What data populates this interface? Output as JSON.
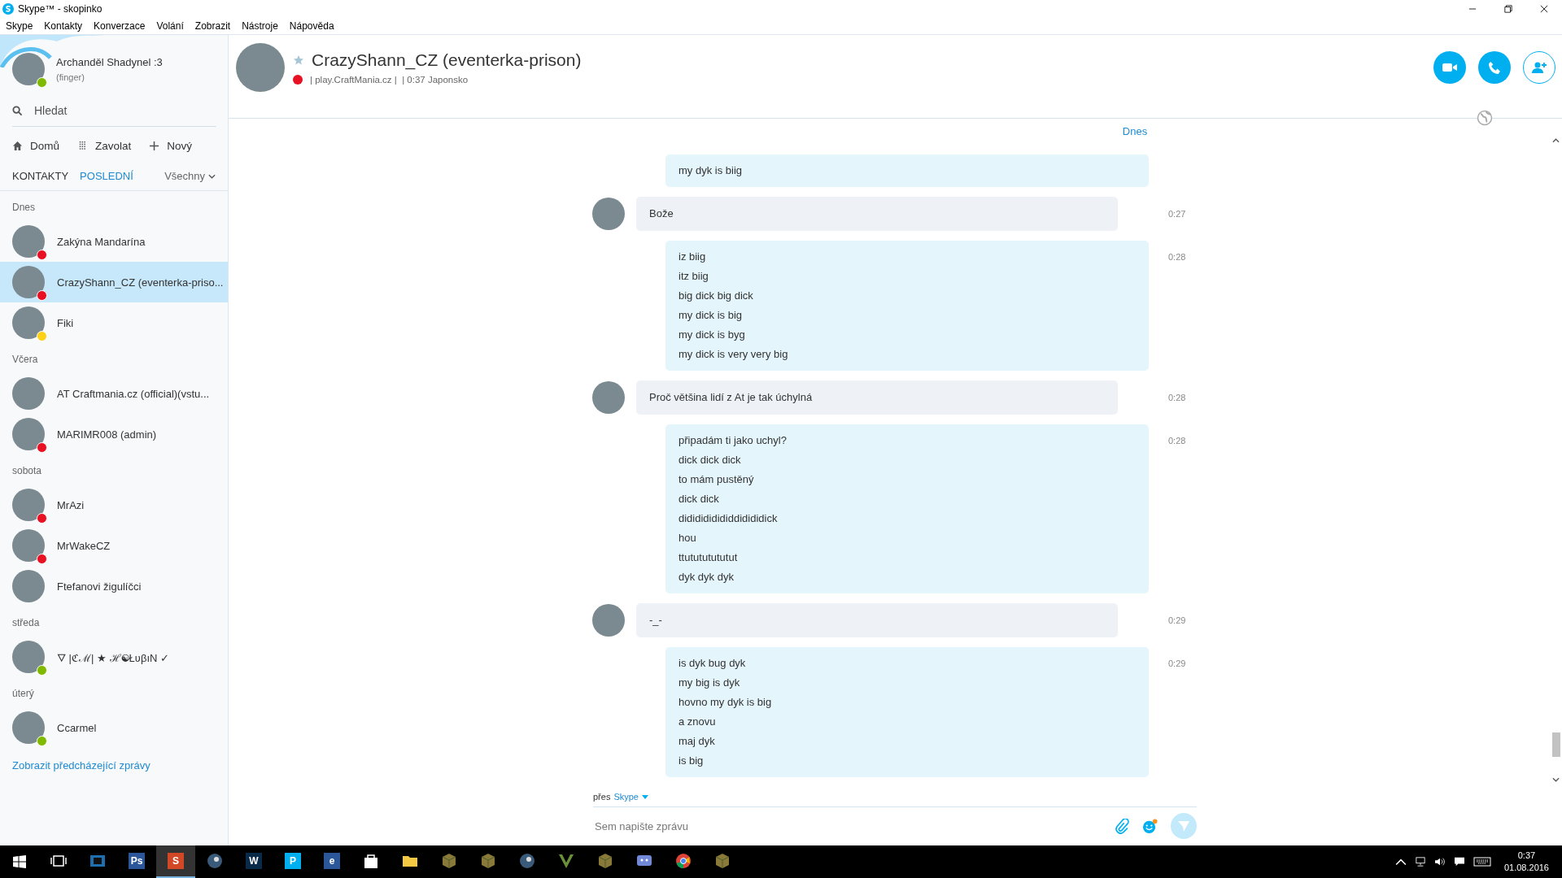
{
  "window": {
    "title": "Skype™ - skopinko"
  },
  "menu": [
    "Skype",
    "Kontakty",
    "Konverzace",
    "Volání",
    "Zobrazit",
    "Nástroje",
    "Nápověda"
  ],
  "profile": {
    "name": "Archanděl Shadynel :3",
    "mood": "(finger)",
    "color": "#7fba00"
  },
  "search": {
    "placeholder": "Hledat"
  },
  "nav": [
    {
      "kind": "home",
      "label": "Domů"
    },
    {
      "kind": "dialpad",
      "label": "Zavolat"
    },
    {
      "kind": "new",
      "label": "Nový"
    }
  ],
  "tabs": [
    {
      "label": "KONTAKTY",
      "selected": false
    },
    {
      "label": "POSLEDNÍ",
      "selected": true
    }
  ],
  "filter": "Všechny",
  "groups": [
    {
      "day": "Dnes",
      "contacts": [
        {
          "name": "Zakýna Mandarína",
          "color": "#e81123",
          "selected": false
        },
        {
          "name": "CrazyShann_CZ (eventerka-priso...",
          "color": "#e81123",
          "selected": true
        },
        {
          "name": "Fiki",
          "color": "#fcd116",
          "selected": false
        }
      ]
    },
    {
      "day": "Včera",
      "contacts": [
        {
          "name": "AT Craftmania.cz (official)(vstu...",
          "selected": false
        },
        {
          "name": "MARIMR008 (admin)",
          "color": "#e81123",
          "selected": false
        }
      ]
    },
    {
      "day": "sobota",
      "contacts": [
        {
          "name": "MrAzi",
          "color": "#e81123",
          "selected": false
        },
        {
          "name": "MrWakeCZ",
          "color": "#e81123",
          "selected": false
        },
        {
          "name": "Ftefanovi žigulíčci",
          "selected": false
        }
      ]
    },
    {
      "day": "středa",
      "contacts": [
        {
          "name": "🜄 |ℭℳ| ★ ℋ☯ŁʋβıN ✓",
          "color": "#7fba00",
          "selected": false
        }
      ]
    },
    {
      "day": "úterý",
      "contacts": [
        {
          "name": "Ccarmel",
          "color": "#7fba00",
          "selected": false
        }
      ]
    }
  ],
  "show_previous": "Zobrazit předcházející zprávy",
  "conversation": {
    "name": "CrazyShann_CZ (eventerka-prison)",
    "color": "#e81123",
    "mood": "| play.CraftMania.cz |  | 0:37 Japonsko"
  },
  "date_header": "Dnes",
  "messages": [
    {
      "kind": "sent",
      "lines": [
        "my dyk is biig"
      ]
    },
    {
      "kind": "received",
      "time": "0:27",
      "lines": [
        "Bože"
      ]
    },
    {
      "kind": "sent",
      "time": "0:28",
      "lines": [
        "iz biig",
        "itz biig",
        "big dick big dick",
        "my dick is big",
        "my dick is byg",
        "my dick is very very big"
      ]
    },
    {
      "kind": "received",
      "time": "0:28",
      "lines": [
        "Proč většina lidí z At je tak úchylná"
      ]
    },
    {
      "kind": "sent",
      "time": "0:28",
      "lines": [
        "připadám ti jako uchyl?",
        "dick dick dick",
        "to mám pustěný",
        "dick dick",
        "dididididididdidididick",
        "hou",
        "ttutututututut",
        "dyk dyk dyk"
      ]
    },
    {
      "kind": "received",
      "time": "0:29",
      "lines": [
        "-_-"
      ]
    },
    {
      "kind": "sent",
      "time": "0:29",
      "lines": [
        "is dyk bug dyk",
        "my big is dyk",
        "hovno my dyk is big",
        "a znovu",
        "maj dyk",
        "is big"
      ]
    }
  ],
  "compose": {
    "via": "přes",
    "service": "Skype",
    "placeholder": "Sem napište zprávu"
  },
  "taskbar": [
    {
      "kind": "taskview",
      "selected": false
    },
    {
      "kind": "film",
      "selected": false
    },
    {
      "kind": "app",
      "label": "Ps",
      "selected": false
    },
    {
      "kind": "app",
      "label": "S",
      "selected": true
    },
    {
      "kind": "steam",
      "selected": false
    },
    {
      "kind": "app",
      "label": "W",
      "selected": false
    },
    {
      "kind": "app",
      "label": "P",
      "selected": false
    },
    {
      "kind": "app",
      "label": "e",
      "selected": false
    },
    {
      "kind": "store",
      "selected": false
    },
    {
      "kind": "folder",
      "selected": false
    },
    {
      "kind": "cube",
      "selected": false
    },
    {
      "kind": "cube",
      "selected": false
    },
    {
      "kind": "steam",
      "selected": false
    },
    {
      "kind": "vee",
      "selected": false
    },
    {
      "kind": "cube",
      "selected": false
    },
    {
      "kind": "chat",
      "selected": false
    },
    {
      "kind": "chrome",
      "selected": false
    },
    {
      "kind": "cube",
      "selected": false
    }
  ],
  "clock": {
    "time": "0:37",
    "date": "01.08.2016"
  }
}
